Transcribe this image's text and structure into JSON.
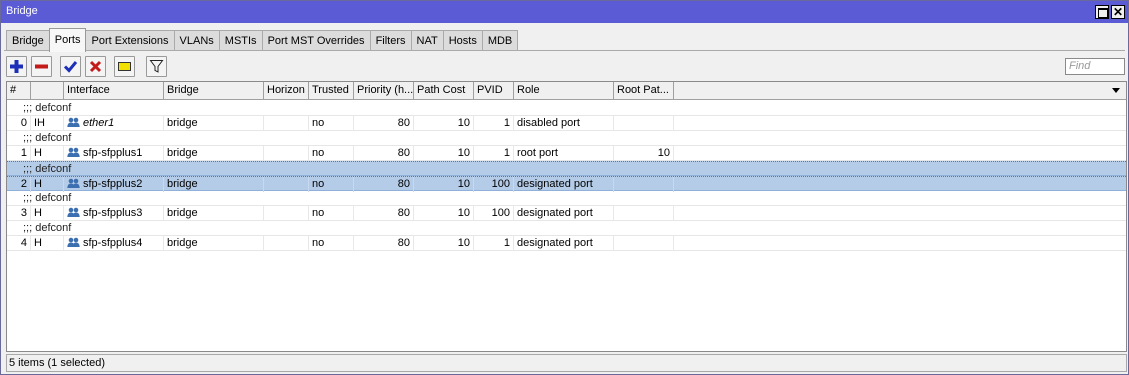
{
  "window": {
    "title": "Bridge"
  },
  "tabs": [
    "Bridge",
    "Ports",
    "Port Extensions",
    "VLANs",
    "MSTIs",
    "Port MST Overrides",
    "Filters",
    "NAT",
    "Hosts",
    "MDB"
  ],
  "active_tab": "Ports",
  "find": {
    "placeholder": "Find"
  },
  "columns": [
    "#",
    "",
    "Interface",
    "Bridge",
    "Horizon",
    "Trusted",
    "Priority (h...",
    "Path Cost",
    "PVID",
    "Role",
    "Root Pat..."
  ],
  "rows": [
    {
      "comment": ";;; defconf",
      "num": "0",
      "flags": "IH",
      "interface": "ether1",
      "interface_italic": true,
      "bridge": "bridge",
      "horizon": "",
      "trusted": "no",
      "priority": "80",
      "path_cost": "10",
      "pvid": "1",
      "role": "disabled port",
      "root_path_cost": "",
      "selected": false
    },
    {
      "comment": ";;; defconf",
      "num": "1",
      "flags": "H",
      "interface": "sfp-sfpplus1",
      "interface_italic": false,
      "bridge": "bridge",
      "horizon": "",
      "trusted": "no",
      "priority": "80",
      "path_cost": "10",
      "pvid": "1",
      "role": "root port",
      "root_path_cost": "10",
      "selected": false
    },
    {
      "comment": ";;; defconf",
      "num": "2",
      "flags": "H",
      "interface": "sfp-sfpplus2",
      "interface_italic": false,
      "bridge": "bridge",
      "horizon": "",
      "trusted": "no",
      "priority": "80",
      "path_cost": "10",
      "pvid": "100",
      "role": "designated port",
      "root_path_cost": "",
      "selected": true
    },
    {
      "comment": ";;; defconf",
      "num": "3",
      "flags": "H",
      "interface": "sfp-sfpplus3",
      "interface_italic": false,
      "bridge": "bridge",
      "horizon": "",
      "trusted": "no",
      "priority": "80",
      "path_cost": "10",
      "pvid": "100",
      "role": "designated port",
      "root_path_cost": "",
      "selected": false
    },
    {
      "comment": ";;; defconf",
      "num": "4",
      "flags": "H",
      "interface": "sfp-sfpplus4",
      "interface_italic": false,
      "bridge": "bridge",
      "horizon": "",
      "trusted": "no",
      "priority": "80",
      "path_cost": "10",
      "pvid": "1",
      "role": "designated port",
      "root_path_cost": "",
      "selected": false
    }
  ],
  "status": {
    "text": "5 items (1 selected)"
  },
  "colors": {
    "title_bar": "#5b5bd6",
    "selection": "#b5cce8",
    "interface_icon": "#3b6fb0"
  },
  "icons": [
    "add-icon",
    "remove-icon",
    "enable-icon",
    "disable-icon",
    "comment-icon",
    "filter-icon",
    "interface-icon",
    "dropdown-icon"
  ]
}
